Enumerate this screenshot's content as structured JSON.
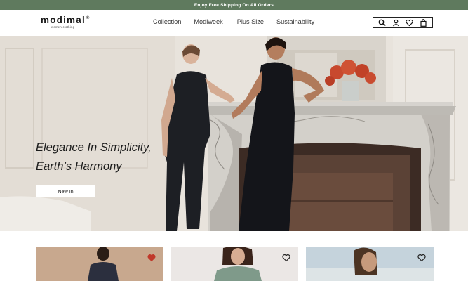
{
  "promo": {
    "text": "Enjoy Free Shipping On All Orders"
  },
  "brand": {
    "name": "modimal",
    "tagline": "women clothing"
  },
  "nav": {
    "items": [
      {
        "label": "Collection"
      },
      {
        "label": "Modiweek"
      },
      {
        "label": "Plus Size"
      },
      {
        "label": "Sustainability"
      }
    ]
  },
  "icons": [
    "search-icon",
    "user-icon",
    "heart-icon",
    "shopping-bag-icon"
  ],
  "hero": {
    "title_line1": "Elegance In Simplicity,",
    "title_line2": "Earth’s Harmony",
    "cta_label": "New In"
  },
  "products": [
    {
      "favorited": true,
      "heart_color": "#c0392b"
    },
    {
      "favorited": false,
      "heart_color": "#222222"
    },
    {
      "favorited": false,
      "heart_color": "#222222"
    }
  ],
  "colors": {
    "promo_bar": "#5f7a5e",
    "text": "#1c1c1c",
    "button_bg": "#ffffff"
  }
}
